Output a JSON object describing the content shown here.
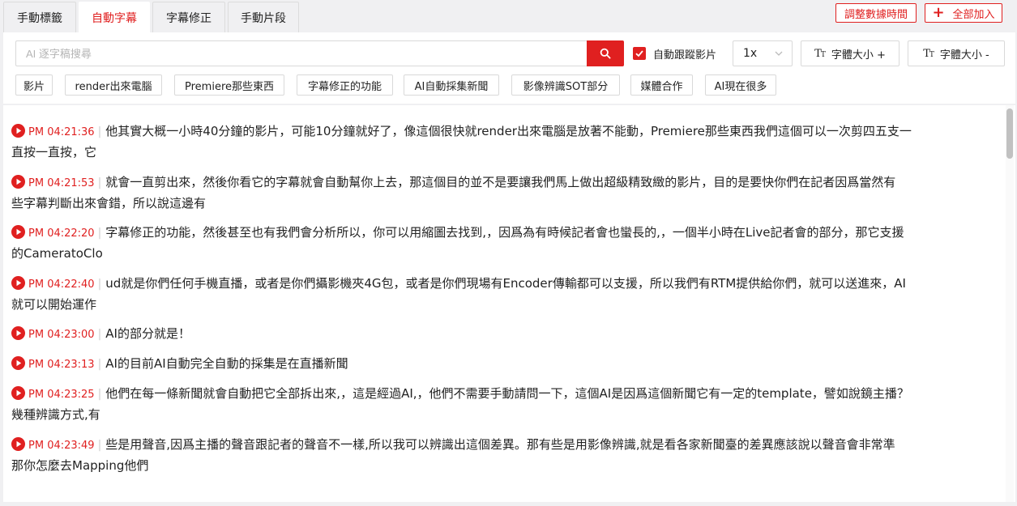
{
  "tabs": [
    {
      "label": "手動標籤",
      "active": false
    },
    {
      "label": "自動字幕",
      "active": true
    },
    {
      "label": "字幕修正",
      "active": false
    },
    {
      "label": "手動片段",
      "active": false
    }
  ],
  "top_actions": {
    "adjust_time_label": "調整數據時間",
    "add_all_label": "全部加入"
  },
  "search": {
    "placeholder": "AI 逐字稿搜尋",
    "value": ""
  },
  "follow_video": {
    "label": "自動跟蹤影片",
    "checked": true
  },
  "speed": {
    "selected": "1x"
  },
  "font_size": {
    "increase_label": "字體大小 +",
    "decrease_label": "字體大小 -"
  },
  "tags": [
    "影片",
    "render出來電腦",
    "Premiere那些東西",
    "字幕修正的功能",
    "AI自動採集新聞",
    "影像辨識SOT部分",
    "媒體合作",
    "AI現在很多"
  ],
  "transcript": [
    {
      "time": "PM 04:21:36",
      "line1": "他其實大概一小時40分鐘的影片，可能10分鐘就好了，像這個很快就render出來電腦是放著不能動，Premiere那些東西我們這個可以一次剪四五支一",
      "line2": "直按一直按，它"
    },
    {
      "time": "PM 04:21:53",
      "line1": "就會一直剪出來，然後你看它的字幕就會自動幫你上去，那這個目的並不是要讓我們馬上做出超級精致緻的影片，目的是要快你們在記者因爲當然有",
      "line2": "些字幕判斷出來會錯，所以說這邊有"
    },
    {
      "time": "PM 04:22:20",
      "line1": "字幕修正的功能，然後甚至也有我們會分析所以，你可以用縮圖去找到,，因爲為有時候記者會也蠻長的,，一個半小時在Live記者會的部分，那它支援",
      "line2": "的CameratoClo"
    },
    {
      "time": "PM 04:22:40",
      "line1": "ud就是你們任何手機直播，或者是你們攝影機夾4G包，或者是你們現場有Encoder傳輸都可以支援，所以我們有RTM提供給你們，就可以送進來，AI",
      "line2": "就可以開始運作"
    },
    {
      "time": "PM 04:23:00",
      "line1": "AI的部分就是！",
      "line2": ""
    },
    {
      "time": "PM 04:23:13",
      "line1": "AI的目前AI自動完全自動的採集是在直播新聞",
      "line2": ""
    },
    {
      "time": "PM 04:23:25",
      "line1": "他們在每一條新聞就會自動把它全部拆出來,，這是經過AI,，他們不需要手動請問一下，這個AI是因爲這個新聞它有一定的template，譬如說鏡主播？",
      "line2": "幾種辨識方式,有"
    },
    {
      "time": "PM 04:23:49",
      "line1": "些是用聲音,因爲主播的聲音跟記者的聲音不一樣,所以我可以辨識出這個差異。那有些是用影像辨識,就是看各家新聞臺的差異應該說以聲音會非常準",
      "line2": "那你怎麼去Mapping他們"
    }
  ],
  "colors": {
    "accent": "#e02020",
    "background": "#f0f0f2",
    "panel": "#ffffff",
    "border": "#d9d9d9"
  },
  "icons": {
    "search": "search-icon",
    "checkbox": "check-icon",
    "select": "chevron-down-icon",
    "font": "font-size-icon",
    "play": "play-circle-icon",
    "add": "plus-icon"
  }
}
